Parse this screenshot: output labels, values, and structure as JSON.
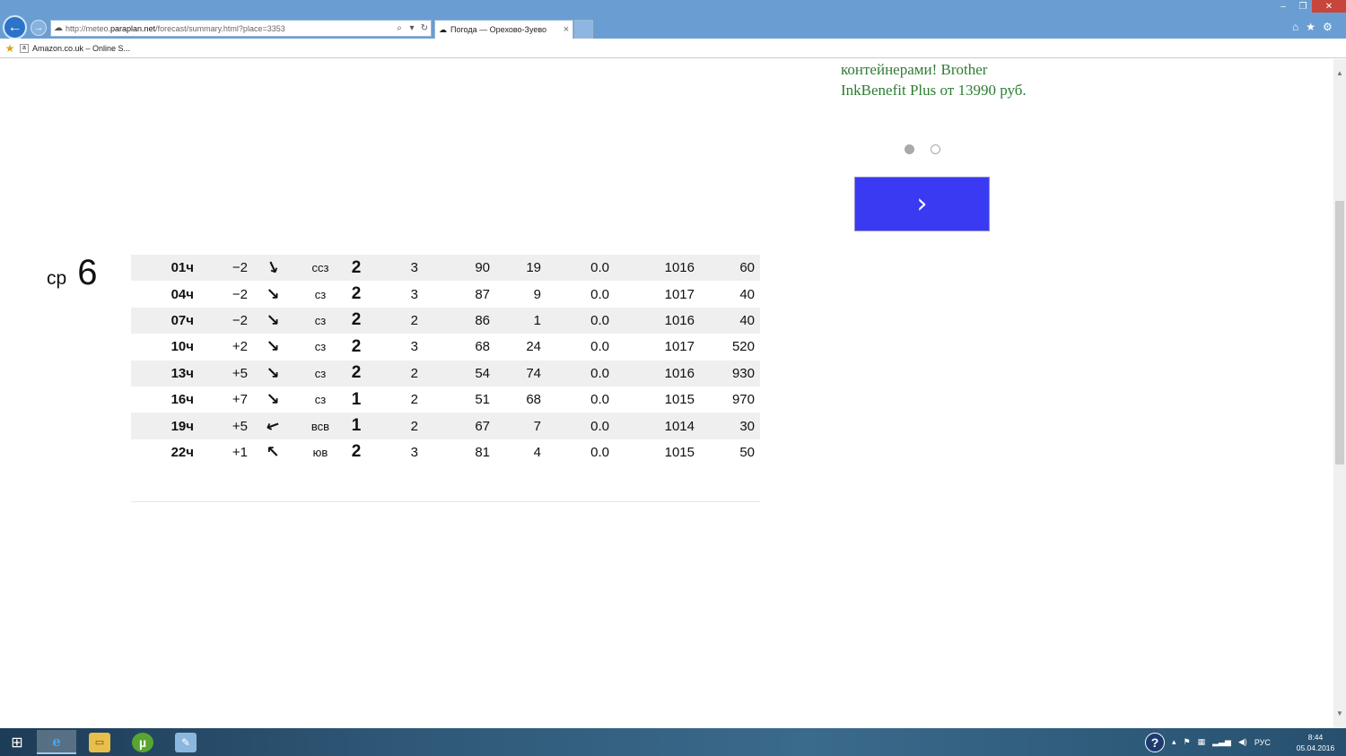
{
  "browser": {
    "url_prefix": "http://meteo.",
    "url_domain": "paraplan.net",
    "url_path": "/forecast/summary.html?place=3353",
    "tab_title": "Погода — Орехово-Зуево",
    "favorites": [
      {
        "label": "Amazon.co.uk – Online S..."
      }
    ]
  },
  "ad": {
    "text": "контейнерами! Brother InkBenefit Plus от 13990 руб.",
    "next_symbol": "›",
    "accent_color": "#3a3af2",
    "text_color": "#2e7d32"
  },
  "day": {
    "weekday": "ср",
    "number": "6"
  },
  "forecast_rows": [
    {
      "time": "01ч",
      "temp": "−2",
      "arrow": "↘",
      "arrow_rotation_deg": 20,
      "dir": "ссз",
      "wind": "2",
      "gust": "3",
      "humidity": "90",
      "cloud": "19",
      "precip": "0.0",
      "pressure": "1016",
      "visibility": "60"
    },
    {
      "time": "04ч",
      "temp": "−2",
      "arrow": "↘",
      "arrow_rotation_deg": 0,
      "dir": "сз",
      "wind": "2",
      "gust": "3",
      "humidity": "87",
      "cloud": "9",
      "precip": "0.0",
      "pressure": "1017",
      "visibility": "40"
    },
    {
      "time": "07ч",
      "temp": "−2",
      "arrow": "↘",
      "arrow_rotation_deg": 0,
      "dir": "сз",
      "wind": "2",
      "gust": "2",
      "humidity": "86",
      "cloud": "1",
      "precip": "0.0",
      "pressure": "1016",
      "visibility": "40"
    },
    {
      "time": "10ч",
      "temp": "+2",
      "arrow": "↘",
      "arrow_rotation_deg": 0,
      "dir": "сз",
      "wind": "2",
      "gust": "3",
      "humidity": "68",
      "cloud": "24",
      "precip": "0.0",
      "pressure": "1017",
      "visibility": "520"
    },
    {
      "time": "13ч",
      "temp": "+5",
      "arrow": "↘",
      "arrow_rotation_deg": 0,
      "dir": "сз",
      "wind": "2",
      "gust": "2",
      "humidity": "54",
      "cloud": "74",
      "precip": "0.0",
      "pressure": "1016",
      "visibility": "930"
    },
    {
      "time": "16ч",
      "temp": "+7",
      "arrow": "↘",
      "arrow_rotation_deg": 0,
      "dir": "сз",
      "wind": "1",
      "gust": "2",
      "humidity": "51",
      "cloud": "68",
      "precip": "0.0",
      "pressure": "1015",
      "visibility": "970"
    },
    {
      "time": "19ч",
      "temp": "+5",
      "arrow": "↙",
      "arrow_rotation_deg": 25,
      "dir": "всв",
      "wind": "1",
      "gust": "2",
      "humidity": "67",
      "cloud": "7",
      "precip": "0.0",
      "pressure": "1014",
      "visibility": "30"
    },
    {
      "time": "22ч",
      "temp": "+1",
      "arrow": "↖",
      "arrow_rotation_deg": 0,
      "dir": "юв",
      "wind": "2",
      "gust": "3",
      "humidity": "81",
      "cloud": "4",
      "precip": "0.0",
      "pressure": "1015",
      "visibility": "50"
    }
  ],
  "taskbar": {
    "start_icon": "windows-logo-icon",
    "apps": [
      "internet-explorer-icon",
      "file-explorer-icon",
      "utorrent-icon",
      "paint-icon"
    ],
    "language": "РУС",
    "time": "8:44",
    "date": "05.04.2016"
  }
}
